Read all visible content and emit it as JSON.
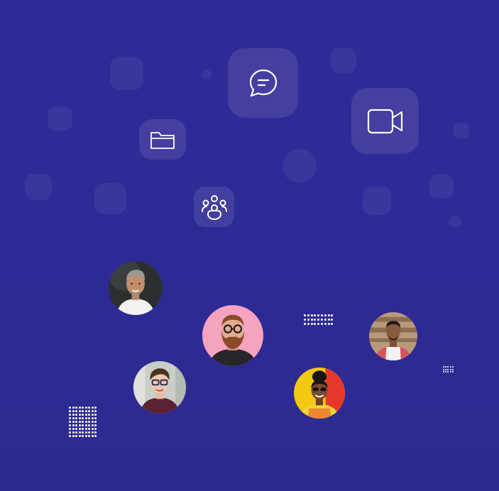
{
  "icons": {
    "chat": "chat-bubble-icon",
    "video": "video-camera-icon",
    "folder": "folder-icon",
    "group": "people-group-icon"
  },
  "avatars": [
    {
      "name": "avatar-gray-haired-man",
      "bg": "#2b2f30"
    },
    {
      "name": "avatar-bearded-man-glasses",
      "bg": "#f5a3bf"
    },
    {
      "name": "avatar-man-apron",
      "bg": "#b89a7a"
    },
    {
      "name": "avatar-young-man-glasses",
      "bg": "#c9cec6"
    },
    {
      "name": "avatar-woman-sunglasses",
      "bg": "#f2c811"
    }
  ],
  "colors": {
    "background": "#2f2a97",
    "tile": "#4a46c4",
    "icon_stroke": "#ffffff"
  }
}
